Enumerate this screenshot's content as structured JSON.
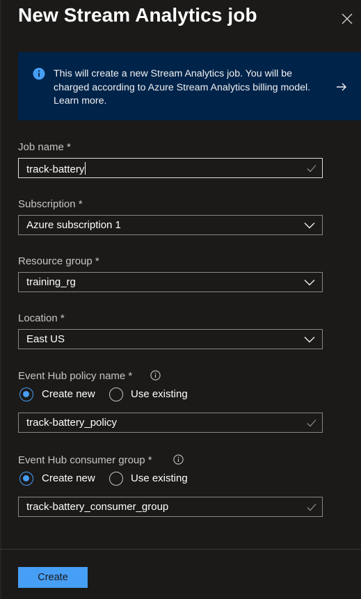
{
  "panel": {
    "title": "New Stream Analytics job",
    "close_icon": "close-icon"
  },
  "info": {
    "icon": "info-icon",
    "text_line1": "This will create a new Stream Analytics job. You will be",
    "text_line2": "charged according to Azure Stream Analytics billing model.",
    "text_line3": "Learn more.",
    "arrow_icon": "arrow-right-icon"
  },
  "form": {
    "job_name": {
      "label": "Job name *",
      "value": "track-battery"
    },
    "subscription": {
      "label": "Subscription *",
      "value": "Azure subscription 1"
    },
    "resource_group": {
      "label": "Resource group *",
      "value": "training_rg"
    },
    "location": {
      "label": "Location *",
      "value": "East US"
    },
    "policy": {
      "label": "Event Hub policy name *",
      "options": [
        "Create new",
        "Use existing"
      ],
      "selected": "Create new",
      "value": "track-battery_policy"
    },
    "consumer_group": {
      "label": "Event Hub consumer group *",
      "options": [
        "Create new",
        "Use existing"
      ],
      "selected": "Create new",
      "value": "track-battery_consumer_group"
    }
  },
  "footer": {
    "create_label": "Create"
  },
  "colors": {
    "background": "#1b1a19",
    "info_banner": "#00234a",
    "accent": "#479ef5",
    "border": "#8a8886"
  }
}
